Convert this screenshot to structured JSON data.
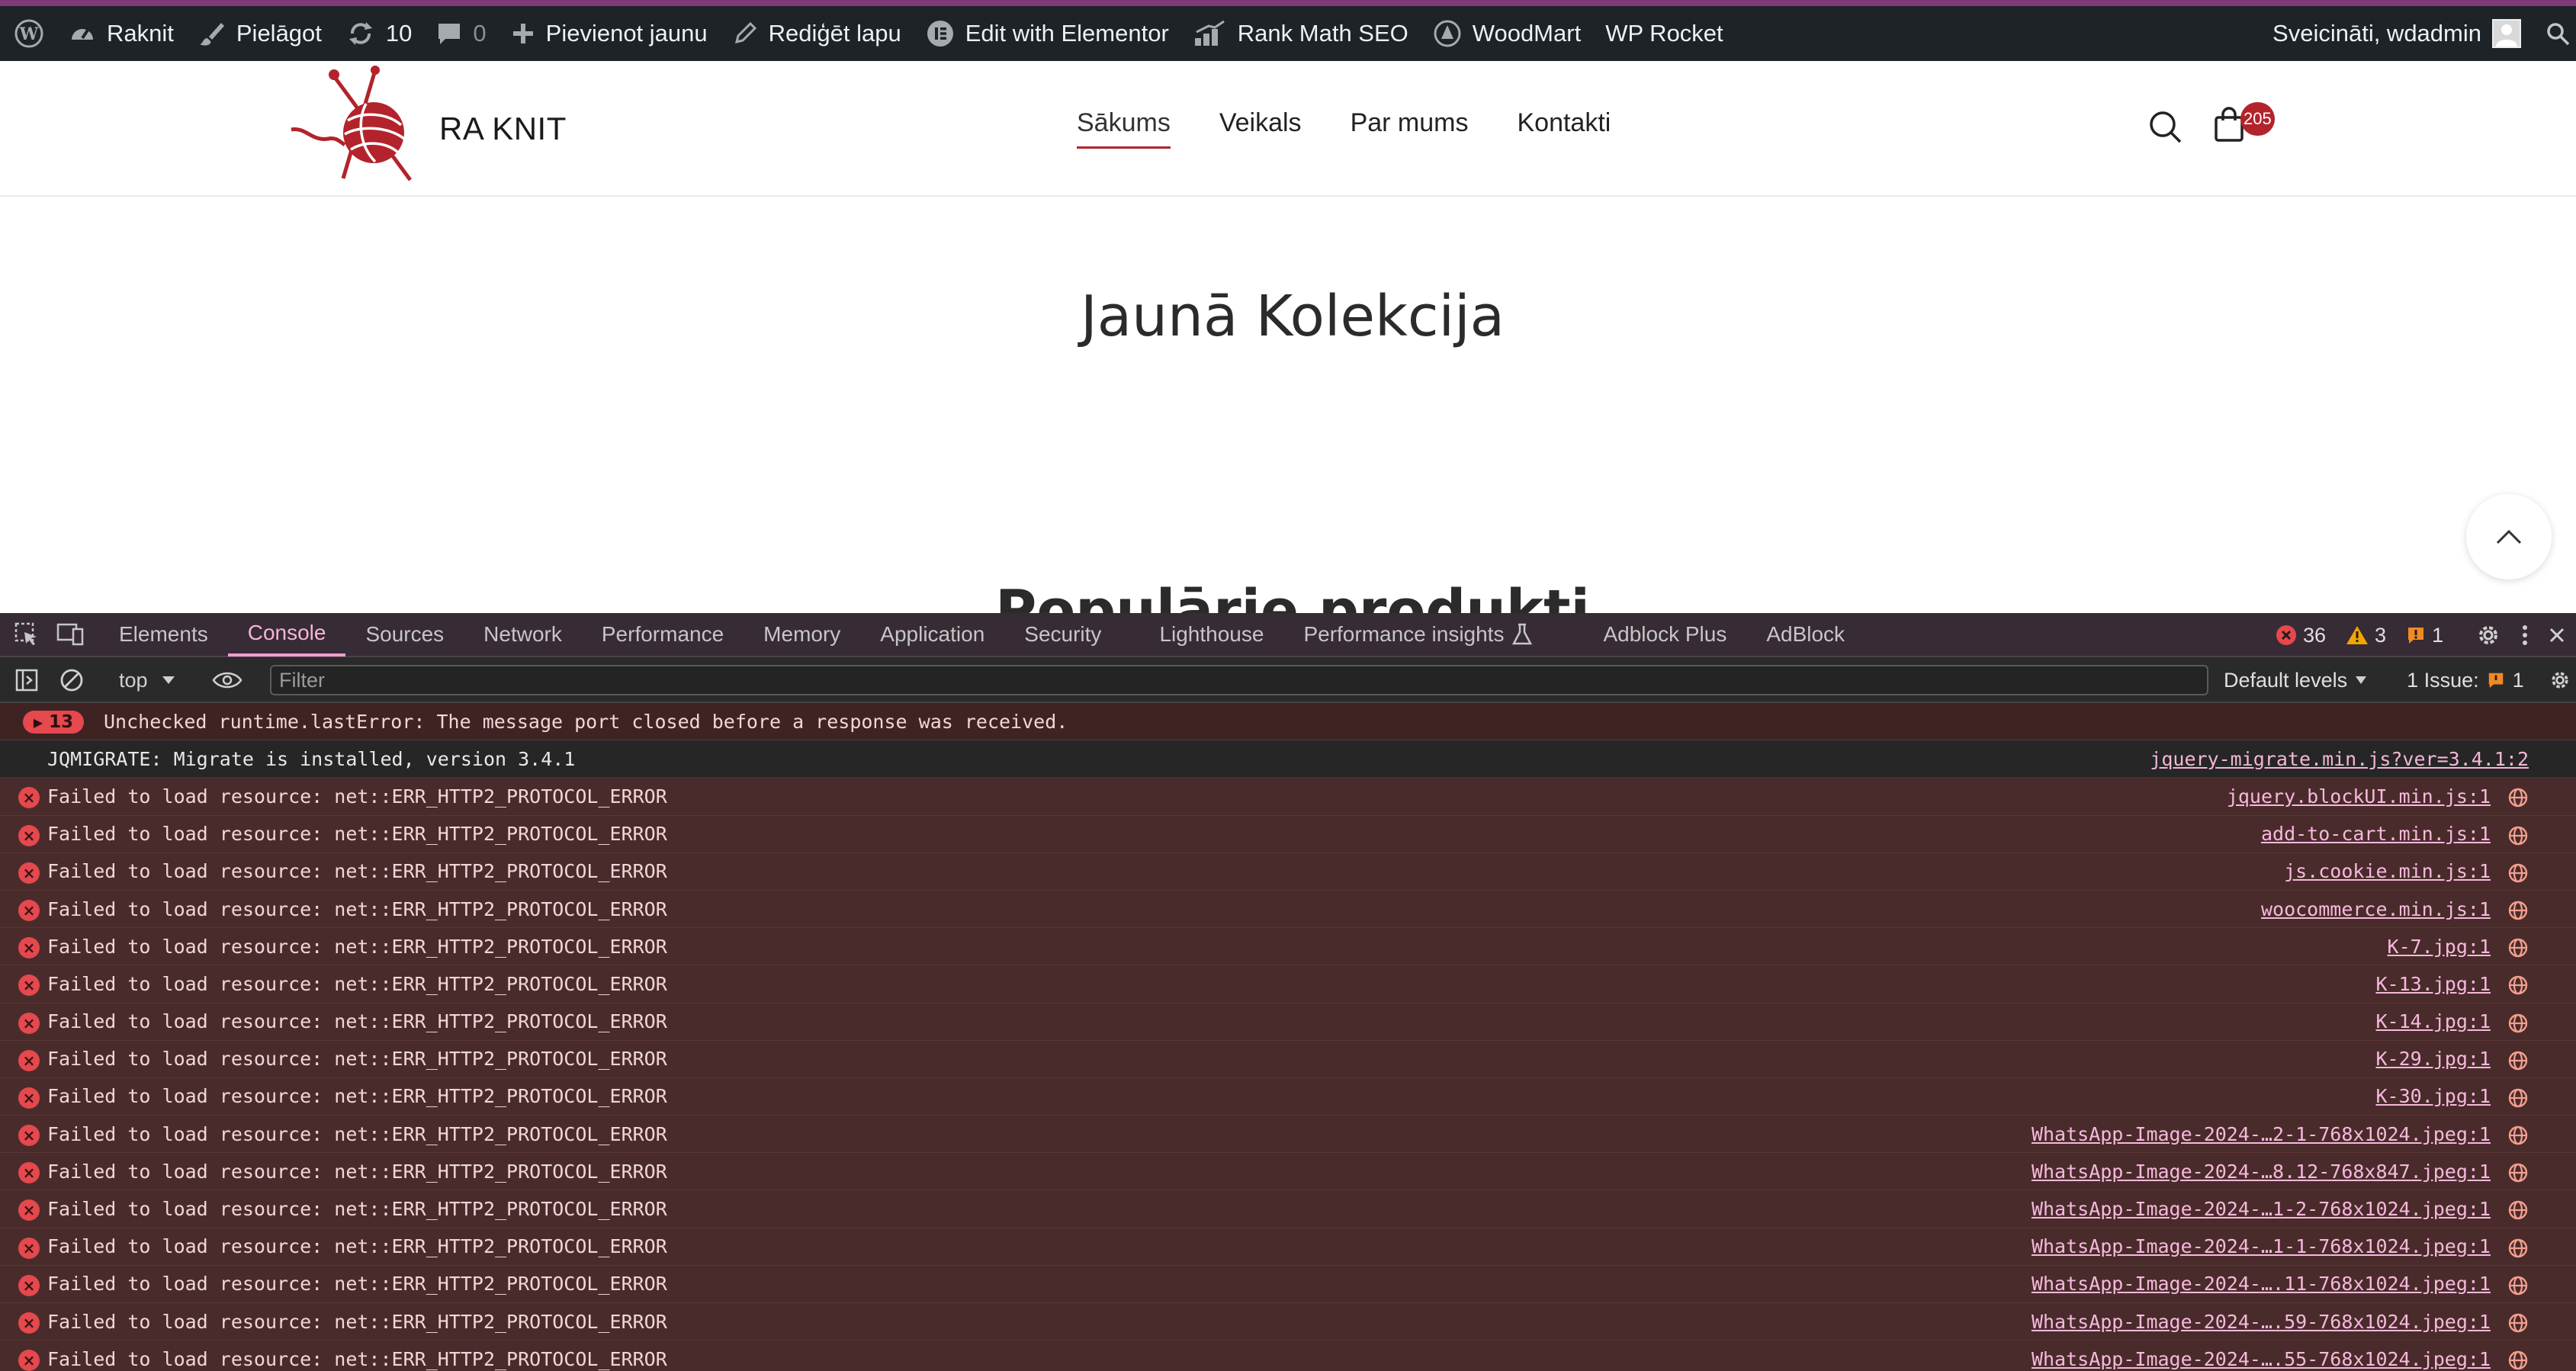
{
  "admin_bar": {
    "site_name": "Raknit",
    "customize": "Pielāgot",
    "updates_count": "10",
    "comments_count": "0",
    "new_content": "Pievienot jaunu",
    "edit_page": "Rediģēt lapu",
    "elementor": "Edit with Elementor",
    "rank_math": "Rank Math SEO",
    "woodmart": "WoodMart",
    "wp_rocket": "WP Rocket",
    "greeting": "Sveicināti, wdadmin"
  },
  "site_header": {
    "logo_text": "RA KNIT",
    "nav": [
      "Sākums",
      "Veikals",
      "Par mums",
      "Kontakti"
    ],
    "cart_count": "205"
  },
  "page": {
    "section1_title": "Jaunā Kolekcija",
    "section2_title": "Populārie produkti"
  },
  "devtools": {
    "tabs": [
      "Elements",
      "Console",
      "Sources",
      "Network",
      "Performance",
      "Memory",
      "Application",
      "Security",
      "Lighthouse",
      "Performance insights",
      "Adblock Plus",
      "AdBlock"
    ],
    "active_tab": "Console",
    "error_count": "36",
    "warning_count": "3",
    "info_count": "1",
    "context": "top",
    "filter_placeholder": "Filter",
    "levels": "Default levels",
    "issues_label": "1 Issue:",
    "issues_count": "1",
    "messages": [
      {
        "type": "first",
        "count": "13",
        "text": "Unchecked runtime.lastError: The message port closed before a response was received.",
        "source": ""
      },
      {
        "type": "info",
        "text": "JQMIGRATE: Migrate is installed, version 3.4.1",
        "source": "jquery-migrate.min.js?ver=3.4.1:2"
      },
      {
        "type": "err",
        "text": "Failed to load resource: net::ERR_HTTP2_PROTOCOL_ERROR",
        "source": "jquery.blockUI.min.js:1"
      },
      {
        "type": "err",
        "text": "Failed to load resource: net::ERR_HTTP2_PROTOCOL_ERROR",
        "source": "add-to-cart.min.js:1"
      },
      {
        "type": "err",
        "text": "Failed to load resource: net::ERR_HTTP2_PROTOCOL_ERROR",
        "source": "js.cookie.min.js:1"
      },
      {
        "type": "err",
        "text": "Failed to load resource: net::ERR_HTTP2_PROTOCOL_ERROR",
        "source": "woocommerce.min.js:1"
      },
      {
        "type": "err",
        "text": "Failed to load resource: net::ERR_HTTP2_PROTOCOL_ERROR",
        "source": "K-7.jpg:1"
      },
      {
        "type": "err",
        "text": "Failed to load resource: net::ERR_HTTP2_PROTOCOL_ERROR",
        "source": "K-13.jpg:1"
      },
      {
        "type": "err",
        "text": "Failed to load resource: net::ERR_HTTP2_PROTOCOL_ERROR",
        "source": "K-14.jpg:1"
      },
      {
        "type": "err",
        "text": "Failed to load resource: net::ERR_HTTP2_PROTOCOL_ERROR",
        "source": "K-29.jpg:1"
      },
      {
        "type": "err",
        "text": "Failed to load resource: net::ERR_HTTP2_PROTOCOL_ERROR",
        "source": "K-30.jpg:1"
      },
      {
        "type": "err",
        "text": "Failed to load resource: net::ERR_HTTP2_PROTOCOL_ERROR",
        "source": "WhatsApp-Image-2024-…2-1-768x1024.jpeg:1"
      },
      {
        "type": "err",
        "text": "Failed to load resource: net::ERR_HTTP2_PROTOCOL_ERROR",
        "source": "WhatsApp-Image-2024-…8.12-768x847.jpeg:1"
      },
      {
        "type": "err",
        "text": "Failed to load resource: net::ERR_HTTP2_PROTOCOL_ERROR",
        "source": "WhatsApp-Image-2024-…1-2-768x1024.jpeg:1"
      },
      {
        "type": "err",
        "text": "Failed to load resource: net::ERR_HTTP2_PROTOCOL_ERROR",
        "source": "WhatsApp-Image-2024-…1-1-768x1024.jpeg:1"
      },
      {
        "type": "err",
        "text": "Failed to load resource: net::ERR_HTTP2_PROTOCOL_ERROR",
        "source": "WhatsApp-Image-2024-….11-768x1024.jpeg:1"
      },
      {
        "type": "err",
        "text": "Failed to load resource: net::ERR_HTTP2_PROTOCOL_ERROR",
        "source": "WhatsApp-Image-2024-….59-768x1024.jpeg:1"
      },
      {
        "type": "err",
        "text": "Failed to load resource: net::ERR_HTTP2_PROTOCOL_ERROR",
        "source": "WhatsApp-Image-2024-….55-768x1024.jpeg:1"
      }
    ]
  },
  "colors": {
    "admin_bar_bg": "#1d2327",
    "admin_bar_accent": "#7e3a7b",
    "brand_red": "#b3232b",
    "devtools_accent": "#f29dcf",
    "error_red": "#e5484d"
  }
}
